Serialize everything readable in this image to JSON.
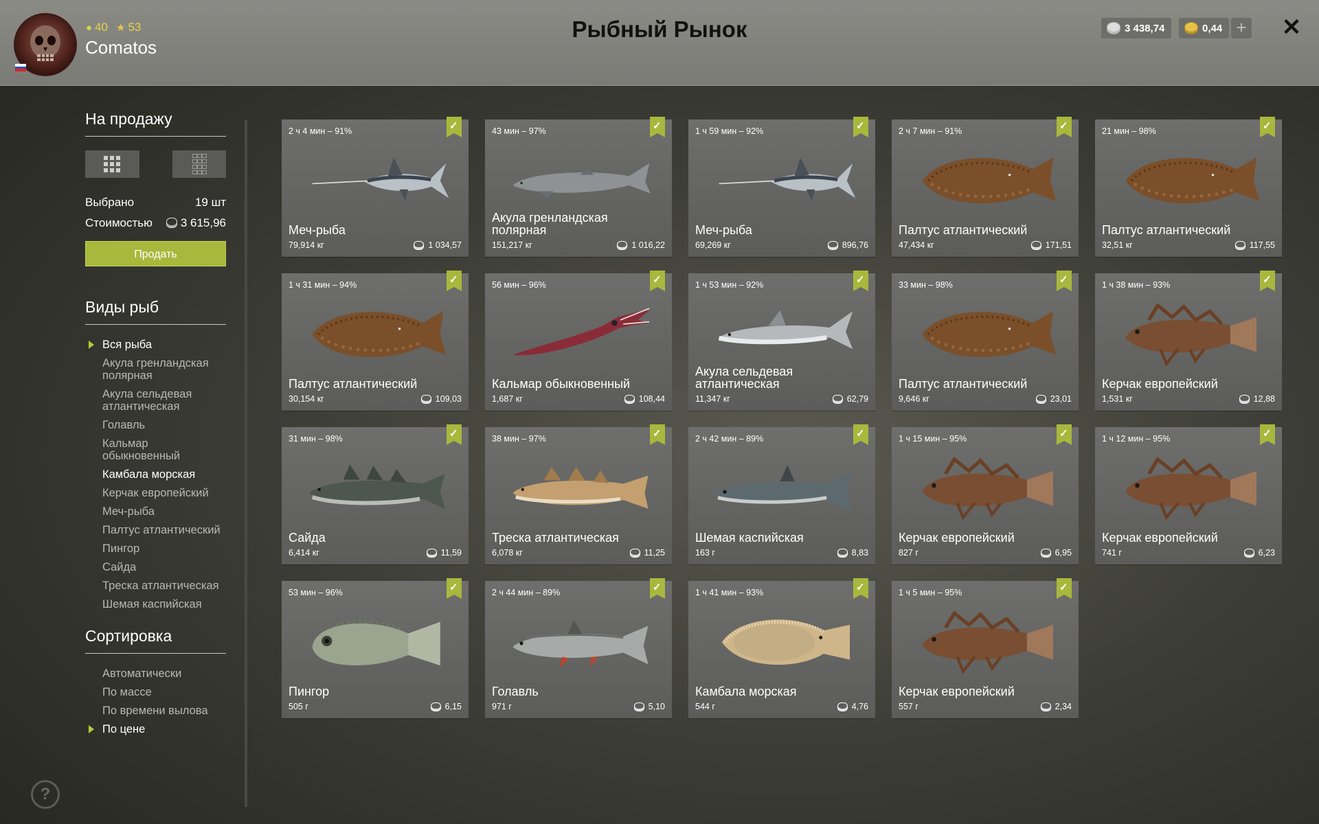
{
  "header": {
    "title": "Рыбный Рынок",
    "username": "Comatos",
    "level": "40",
    "rank": "53",
    "silver": "3 438,74",
    "gold": "0,44",
    "plus_label": "+",
    "close_label": "✕"
  },
  "sidebar": {
    "sale_title": "На продажу",
    "selected_label": "Выбрано",
    "selected_value": "19 шт",
    "cost_label": "Стоимостью",
    "cost_value": "3 615,96",
    "sell_label": "Продать",
    "species_title": "Виды рыб",
    "species": [
      {
        "label": "Вся рыба",
        "active": true,
        "marker": true
      },
      {
        "label": "Акула гренландская полярная"
      },
      {
        "label": "Акула сельдевая атлантическая"
      },
      {
        "label": "Голавль"
      },
      {
        "label": "Кальмар обыкновенный"
      },
      {
        "label": "Камбала морская",
        "active": true
      },
      {
        "label": "Керчак европейский"
      },
      {
        "label": "Меч-рыба"
      },
      {
        "label": "Палтус атлантический"
      },
      {
        "label": "Пингор"
      },
      {
        "label": "Сайда"
      },
      {
        "label": "Треска атлантическая"
      },
      {
        "label": "Шемая каспийская"
      }
    ],
    "sort_title": "Сортировка",
    "sort": [
      {
        "label": "Автоматически"
      },
      {
        "label": "По массе"
      },
      {
        "label": "По времени вылова"
      },
      {
        "label": "По цене",
        "active": true,
        "marker": true
      }
    ],
    "help_label": "?"
  },
  "fish": [
    {
      "time": "2 ч 4 мин – 91%",
      "name": "Меч-рыба",
      "weight": "79,914 кг",
      "price": "1 034,57",
      "kind": "swordfish"
    },
    {
      "time": "43 мин – 97%",
      "name": "Акула гренландская полярная",
      "weight": "151,217 кг",
      "price": "1 016,22",
      "kind": "greenshark"
    },
    {
      "time": "1 ч 59 мин – 92%",
      "name": "Меч-рыба",
      "weight": "69,269 кг",
      "price": "896,76",
      "kind": "swordfish"
    },
    {
      "time": "2 ч 7 мин – 91%",
      "name": "Палтус атлантический",
      "weight": "47,434 кг",
      "price": "171,51",
      "kind": "halibut"
    },
    {
      "time": "21 мин – 98%",
      "name": "Палтус атлантический",
      "weight": "32,51 кг",
      "price": "117,55",
      "kind": "halibut"
    },
    {
      "time": "1 ч 31 мин – 94%",
      "name": "Палтус атлантический",
      "weight": "30,154 кг",
      "price": "109,03",
      "kind": "halibut"
    },
    {
      "time": "56 мин – 96%",
      "name": "Кальмар обыкновенный",
      "weight": "1,687 кг",
      "price": "108,44",
      "kind": "squid"
    },
    {
      "time": "1 ч 53 мин – 92%",
      "name": "Акула сельдевая атлантическая",
      "weight": "11,347 кг",
      "price": "62,79",
      "kind": "porbeagle"
    },
    {
      "time": "33 мин – 98%",
      "name": "Палтус атлантический",
      "weight": "9,646 кг",
      "price": "23,01",
      "kind": "halibut"
    },
    {
      "time": "1 ч 38 мин – 93%",
      "name": "Керчак европейский",
      "weight": "1,531 кг",
      "price": "12,88",
      "kind": "sculpin"
    },
    {
      "time": "31 мин – 98%",
      "name": "Сайда",
      "weight": "6,414 кг",
      "price": "11,59",
      "kind": "saithe"
    },
    {
      "time": "38 мин – 97%",
      "name": "Треска атлантическая",
      "weight": "6,078 кг",
      "price": "11,25",
      "kind": "cod"
    },
    {
      "time": "2 ч 42 мин – 89%",
      "name": "Шемая каспийская",
      "weight": "163 г",
      "price": "8,83",
      "kind": "shemaya"
    },
    {
      "time": "1 ч 15 мин – 95%",
      "name": "Керчак европейский",
      "weight": "827 г",
      "price": "6,95",
      "kind": "sculpin"
    },
    {
      "time": "1 ч 12 мин – 95%",
      "name": "Керчак европейский",
      "weight": "741 г",
      "price": "6,23",
      "kind": "sculpin"
    },
    {
      "time": "53 мин – 96%",
      "name": "Пингор",
      "weight": "505 г",
      "price": "6,15",
      "kind": "lumpsucker"
    },
    {
      "time": "2 ч 44 мин – 89%",
      "name": "Голавль",
      "weight": "971 г",
      "price": "5,10",
      "kind": "chub"
    },
    {
      "time": "1 ч 41 мин – 93%",
      "name": "Камбала морская",
      "weight": "544 г",
      "price": "4,76",
      "kind": "plaice"
    },
    {
      "time": "1 ч 5 мин – 95%",
      "name": "Керчак европейский",
      "weight": "557 г",
      "price": "2,34",
      "kind": "sculpin"
    }
  ],
  "colors": {
    "accent": "#a8b83c",
    "card": "#6a6a68",
    "header": "#85857f"
  }
}
